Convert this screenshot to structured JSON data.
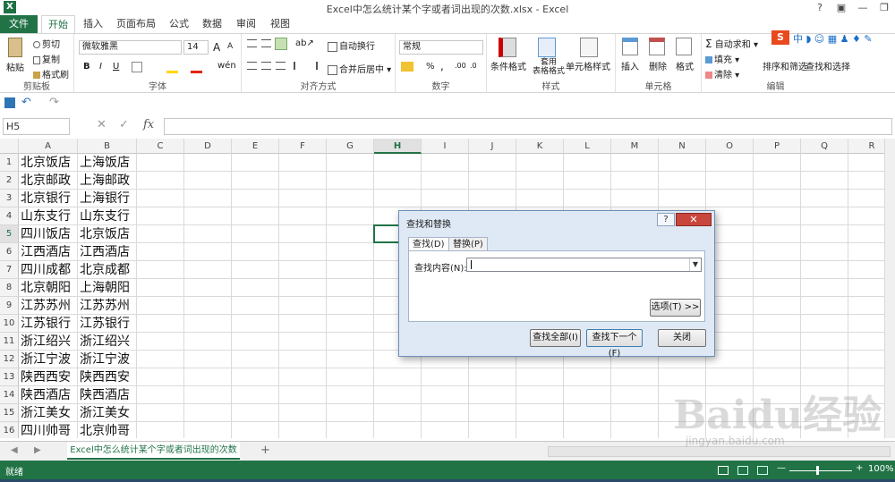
{
  "window": {
    "title": "Excel中怎么统计某个字或者词出现的次数.xlsx - Excel",
    "logo": "X",
    "ctrl_help": "?",
    "ctrl_ribbon": "▣",
    "ctrl_min": "—",
    "ctrl_max": "❐"
  },
  "tabs": [
    "文件",
    "开始",
    "插入",
    "页面布局",
    "公式",
    "数据",
    "审阅",
    "视图"
  ],
  "ribbon": {
    "clipboard": {
      "paste": "粘贴",
      "cut": "剪切",
      "copy": "复制",
      "format_painter": "格式刷",
      "name": "剪贴板"
    },
    "font": {
      "family": "微软雅黑",
      "size": "14",
      "name": "字体",
      "bold": "B",
      "italic": "I",
      "underline": "U",
      "grow": "A",
      "shrink": "A"
    },
    "alignment": {
      "wrap": "自动换行",
      "merge": "合并后居中",
      "name": "对齐方式"
    },
    "number": {
      "format": "常规",
      "percent": "%",
      "comma": ",",
      "name": "数字"
    },
    "styles": {
      "conditional": "条件格式",
      "table": "套用\n表格格式",
      "cell": "单元格样式",
      "name": "样式"
    },
    "cells": {
      "insert": "插入",
      "delete": "删除",
      "format": "格式",
      "name": "单元格"
    },
    "editing": {
      "autosum": "自动求和",
      "fill": "填充",
      "clear": "清除",
      "sort": "排序和筛选",
      "find": "查找和选择",
      "name": "编辑"
    }
  },
  "formula_bar": {
    "name_box": "H5",
    "fx": "fx"
  },
  "columns": [
    "A",
    "B",
    "C",
    "D",
    "E",
    "F",
    "G",
    "H",
    "I",
    "J",
    "K",
    "L",
    "M",
    "N",
    "O",
    "P",
    "Q",
    "R"
  ],
  "selected_column": "H",
  "selected_row": 5,
  "rows": [
    [
      "北京饭店",
      "上海饭店"
    ],
    [
      "北京邮政",
      "上海邮政"
    ],
    [
      "北京银行",
      "上海银行"
    ],
    [
      "山东支行",
      "山东支行"
    ],
    [
      "四川饭店",
      "北京饭店"
    ],
    [
      "江西酒店",
      "江西酒店"
    ],
    [
      "四川成都",
      "北京成都"
    ],
    [
      "北京朝阳",
      "上海朝阳"
    ],
    [
      "江苏苏州",
      "江苏苏州"
    ],
    [
      "江苏银行",
      "江苏银行"
    ],
    [
      "浙江绍兴",
      "浙江绍兴"
    ],
    [
      "浙江宁波",
      "浙江宁波"
    ],
    [
      "陕西西安",
      "陕西西安"
    ],
    [
      "陕西酒店",
      "陕西酒店"
    ],
    [
      "浙江美女",
      "浙江美女"
    ],
    [
      "四川帅哥",
      "北京帅哥"
    ],
    [
      "",
      ""
    ]
  ],
  "sheet_tab": "Excel中怎么统计某个字或者词出现的次数",
  "add_sheet": "+",
  "status": {
    "text": "就绪",
    "zoom": "100%"
  },
  "dialog": {
    "title": "查找和替换",
    "help": "?",
    "close": "✕",
    "tab_find": "查找(D)",
    "tab_replace": "替换(P)",
    "find_label": "查找内容(N):",
    "find_value": "",
    "options": "选项(T) >>",
    "find_all": "查找全部(I)",
    "find_next": "查找下一个(F)",
    "close_btn": "关闭"
  },
  "watermark": {
    "text": "Baidu经验",
    "sub": "jingyan.baidu.com"
  }
}
